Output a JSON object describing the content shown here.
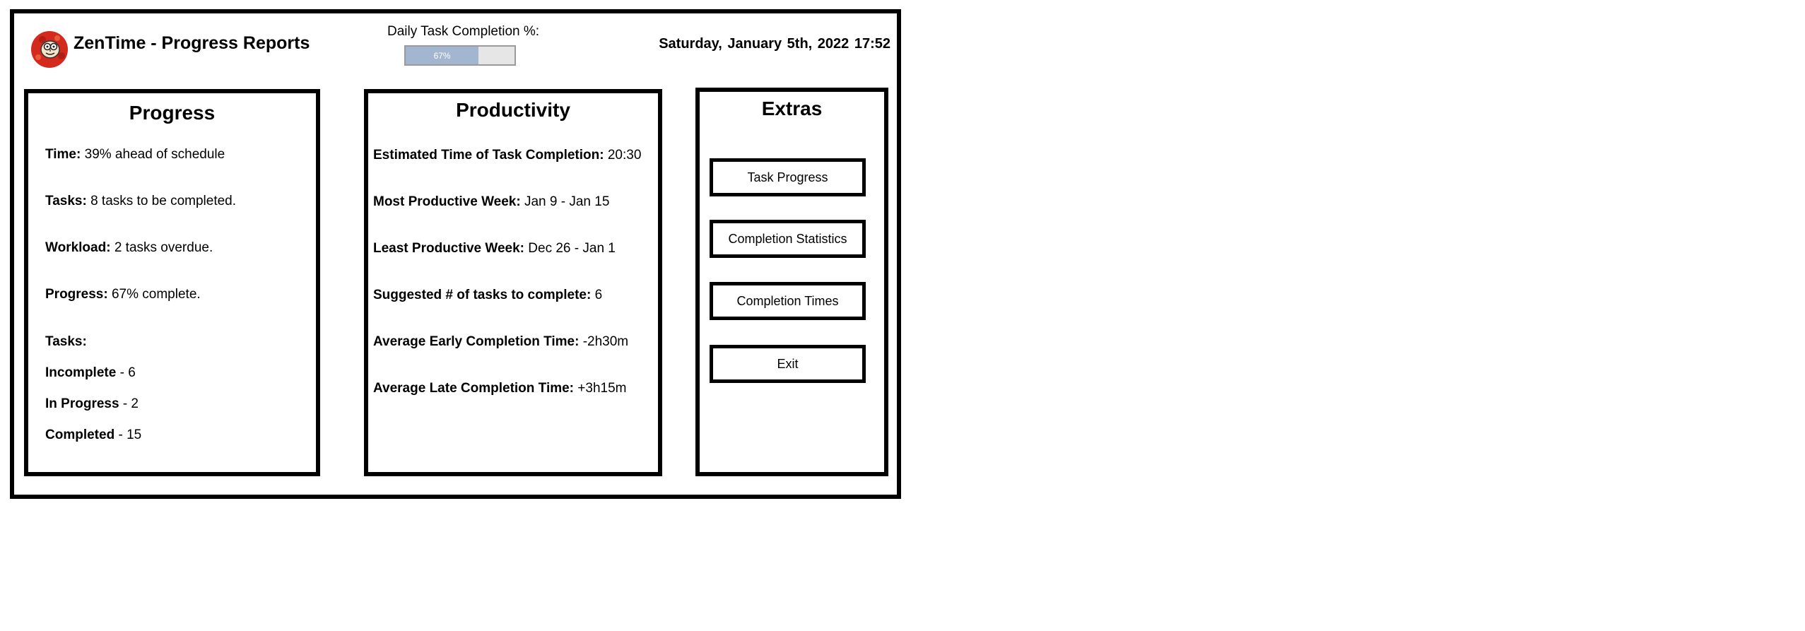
{
  "header": {
    "app_title": "ZenTime - Progress Reports",
    "daily_completion_label": "Daily Task Completion %:",
    "daily_completion_value": 67,
    "daily_completion_text": "67%",
    "datetime": "Saturday, January 5th, 2022 17:52"
  },
  "progress": {
    "title": "Progress",
    "time_label": "Time:",
    "time_value": " 39% ahead of schedule",
    "tasks_label": "Tasks:",
    "tasks_value": " 8 tasks to be completed.",
    "workload_label": "Workload:",
    "workload_value": " 2 tasks overdue.",
    "progress_label": "Progress:",
    "progress_value": " 67% complete.",
    "tasks_heading": "Tasks:",
    "incomplete_label": "Incomplete",
    "incomplete_value": " - 6",
    "in_progress_label": "In Progress",
    "in_progress_value": " - 2",
    "completed_label": "Completed",
    "completed_value": " - 15"
  },
  "productivity": {
    "title": "Productivity",
    "est_label": "Estimated Time of Task Completion:",
    "est_value": " 20:30",
    "most_label": "Most Productive Week:",
    "most_value": " Jan 9 - Jan 15",
    "least_label": "Least Productive Week:",
    "least_value": " Dec 26 - Jan 1",
    "suggested_label": "Suggested # of tasks to complete:",
    "suggested_value": " 6",
    "early_label": "Average Early Completion Time:",
    "early_value": " -2h30m",
    "late_label": "Average Late Completion Time:",
    "late_value": " +3h15m"
  },
  "extras": {
    "title": "Extras",
    "buttons": [
      "Task Progress",
      "Completion Statistics",
      "Completion Times",
      "Exit"
    ]
  },
  "icons": {
    "logo": "zentime-logo-icon"
  },
  "colors": {
    "progress_fill": "#a3b6d0",
    "progress_track": "#e6e6e6",
    "logo_red": "#d42a1e"
  }
}
